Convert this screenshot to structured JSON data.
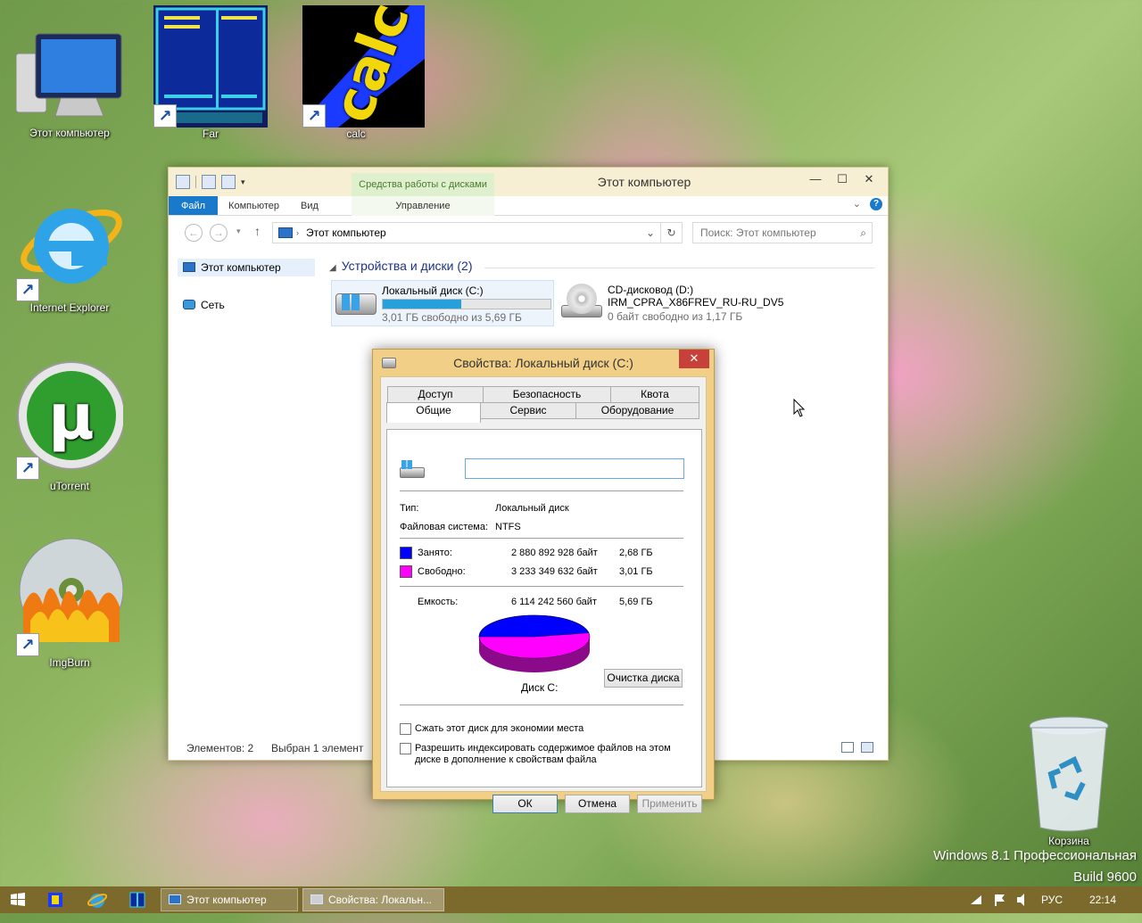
{
  "desktop": {
    "icons": {
      "computer": "Этот компьютер",
      "far": "Far",
      "calc": "calc",
      "ie": "Internet Explorer",
      "utorrent": "uTorrent",
      "imgburn": "ImgBurn",
      "recycle": "Корзина"
    },
    "calc_logo": "calc",
    "watermark_line1": "Windows 8.1 Профессиональная",
    "watermark_line2": "Build 9600"
  },
  "explorer": {
    "title": "Этот компьютер",
    "context_tab": "Средства работы с дисками",
    "ribbon": {
      "file": "Файл",
      "computer": "Компьютер",
      "view": "Вид",
      "manage": "Управление"
    },
    "address": "Этот компьютер",
    "search_placeholder": "Поиск: Этот компьютер",
    "nav": {
      "computer": "Этот компьютер",
      "network": "Сеть"
    },
    "group_header": "Устройства и диски (2)",
    "drives": [
      {
        "name": "Локальный диск (C:)",
        "free_text": "3,01 ГБ свободно из 5,69 ГБ",
        "used_fraction": 0.47
      },
      {
        "name": "CD-дисковод (D:)",
        "label": "IRM_CPRA_X86FREV_RU-RU_DV5",
        "free_text": "0 байт свободно из 1,17 ГБ"
      }
    ],
    "status": {
      "items": "Элементов: 2",
      "selected": "Выбран 1 элемент"
    }
  },
  "properties": {
    "title": "Свойства: Локальный диск (C:)",
    "tabs_row1": [
      "Доступ",
      "Безопасность",
      "Квота"
    ],
    "tabs_row2": [
      "Общие",
      "Сервис",
      "Оборудование"
    ],
    "active_tab": "Общие",
    "name_value": "",
    "type_label": "Тип:",
    "type_value": "Локальный диск",
    "fs_label": "Файловая система:",
    "fs_value": "NTFS",
    "used_label": "Занято:",
    "used_bytes": "2 880 892 928 байт",
    "used_gb": "2,68 ГБ",
    "free_label": "Свободно:",
    "free_bytes": "3 233 349 632 байт",
    "free_gb": "3,01 ГБ",
    "capacity_label": "Емкость:",
    "capacity_bytes": "6 114 242 560 байт",
    "capacity_gb": "5,69 ГБ",
    "disk_label": "Диск C:",
    "cleanup_button": "Очистка диска",
    "compress_label": "Сжать этот диск для экономии места",
    "index_label_1": "Разрешить индексировать содержимое файлов на этом",
    "index_label_2": "диске в дополнение к свойствам файла",
    "ok": "ОК",
    "cancel": "Отмена",
    "apply": "Применить",
    "colors": {
      "used": "#0000ff",
      "free": "#ff00ff"
    },
    "used_fraction": 0.471
  },
  "taskbar": {
    "win1": "Этот компьютер",
    "win2": "Свойства: Локальн...",
    "lang": "РУС",
    "time": "22:14"
  }
}
